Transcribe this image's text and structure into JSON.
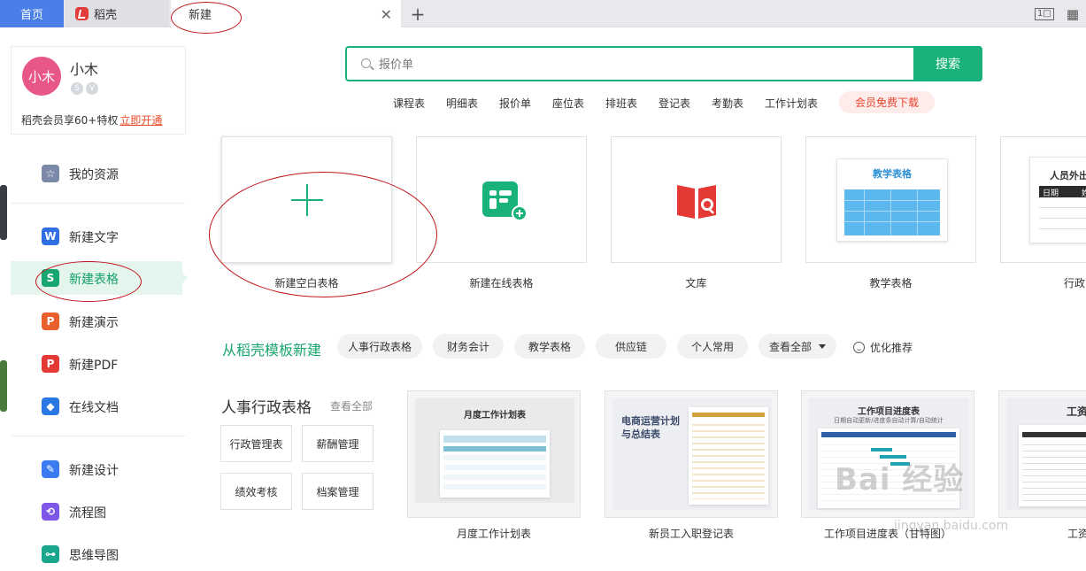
{
  "tabs": [
    {
      "label": "首页"
    },
    {
      "label": "稻壳"
    },
    {
      "label": "新建"
    }
  ],
  "tab_tools": {
    "view": "1□",
    "grid": "▦"
  },
  "user": {
    "avatar_text": "小木",
    "name": "小木",
    "vip_text": "稻壳会员享60+特权",
    "vip_link": "立即开通"
  },
  "sidebar": {
    "items": [
      {
        "label": "我的资源",
        "icon": "star-icon",
        "color": "#7a8aa8"
      },
      {
        "label": "新建文字",
        "icon": "writer-icon",
        "color": "#2f6fe4"
      },
      {
        "label": "新建表格",
        "icon": "spreadsheet-icon",
        "color": "#19a56f"
      },
      {
        "label": "新建演示",
        "icon": "presentation-icon",
        "color": "#e8602c"
      },
      {
        "label": "新建PDF",
        "icon": "pdf-icon",
        "color": "#e53935"
      },
      {
        "label": "在线文档",
        "icon": "cloud-doc-icon",
        "color": "#2a78e4"
      },
      {
        "label": "新建设计",
        "icon": "design-icon",
        "color": "#3b7bf0"
      },
      {
        "label": "流程图",
        "icon": "flowchart-icon",
        "color": "#7e57e8"
      },
      {
        "label": "思维导图",
        "icon": "mindmap-icon",
        "color": "#1aa68a"
      }
    ]
  },
  "search": {
    "placeholder": "报价单",
    "button": "搜索",
    "keywords": [
      "课程表",
      "明细表",
      "报价单",
      "座位表",
      "排班表",
      "登记表",
      "考勤表",
      "工作计划表"
    ],
    "vip_download": "会员免费下载"
  },
  "create_cards": [
    {
      "label": "新建空白表格"
    },
    {
      "label": "新建在线表格"
    },
    {
      "label": "文库"
    },
    {
      "label": "教学表格",
      "thumb_title": "教学表格"
    },
    {
      "label": "行政",
      "thumb_title": "人员外出",
      "thumb_cols": [
        "日期",
        "姓"
      ]
    }
  ],
  "templates": {
    "title": "从稻壳模板新建",
    "chips": [
      "人事行政表格",
      "财务会计",
      "教学表格",
      "供应链",
      "个人常用",
      "查看全部"
    ],
    "recommend": "优化推荐",
    "category_title": "人事行政表格",
    "category_viewall": "查看全部",
    "category_buttons": [
      "行政管理表",
      "薪酬管理",
      "绩效考核",
      "档案管理"
    ],
    "cards": [
      {
        "label": "月度工作计划表",
        "thumb_title": "月度工作计划表"
      },
      {
        "label": "新员工入职登记表",
        "thumb_title": "电商运营计划与总结表"
      },
      {
        "label": "工作项目进度表（甘特图）",
        "thumb_title": "工作项目进度表",
        "thumb_sub": "日期自动更新/进度条自动计算/自动统计"
      },
      {
        "label": "工资",
        "thumb_title": "工资"
      }
    ]
  },
  "watermark": {
    "text": "Bai 经验",
    "url": "jingyan.baidu.com"
  },
  "colors": {
    "accent": "#19b27b",
    "home_tab": "#4b7fe8",
    "annotation": "#c0141a"
  }
}
